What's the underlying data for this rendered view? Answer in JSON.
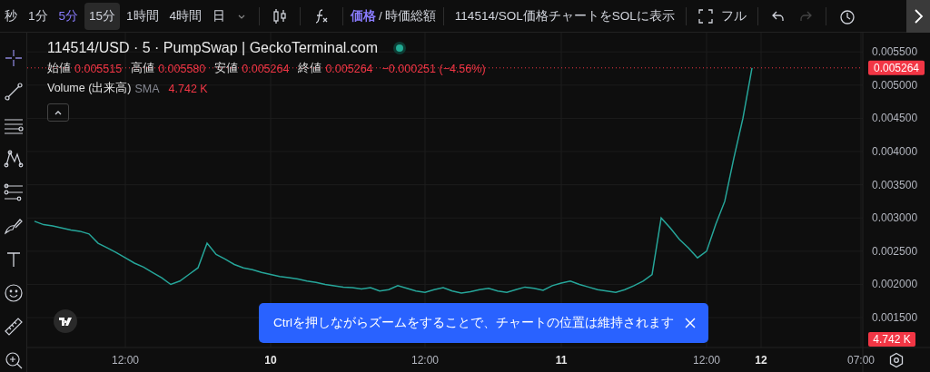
{
  "toolbar": {
    "intervals": [
      {
        "label": "秒",
        "selected": false,
        "hovered": false
      },
      {
        "label": "1分",
        "selected": false,
        "hovered": false
      },
      {
        "label": "5分",
        "selected": true,
        "hovered": false
      },
      {
        "label": "15分",
        "selected": false,
        "hovered": true
      },
      {
        "label": "1時間",
        "selected": false,
        "hovered": false
      },
      {
        "label": "4時間",
        "selected": false,
        "hovered": false
      },
      {
        "label": "日",
        "selected": false,
        "hovered": false
      }
    ],
    "value_toggle": [
      {
        "label": "価格",
        "selected": true
      },
      {
        "label": "時価総額",
        "selected": false
      }
    ],
    "toggle_separator": "/",
    "sol_link": "114514/SOL価格チャートをSOLに表示",
    "fullscreen": "フル",
    "undo": {
      "disabled": false
    },
    "redo": {
      "disabled": true
    }
  },
  "legend": {
    "title": "114514/USD · 5 · PumpSwap | GeckoTerminal.com",
    "market_open": true,
    "ohlc": [
      {
        "label": "始値",
        "value": "0.005515"
      },
      {
        "label": "高値",
        "value": "0.005580"
      },
      {
        "label": "安値",
        "value": "0.005264"
      },
      {
        "label": "終値",
        "value": "0.005264"
      }
    ],
    "change": "−0.000251 (−4.56%)",
    "volume": {
      "label": "Volume (出来高)",
      "study": "SMA",
      "value": "4.742 K"
    }
  },
  "chart": {
    "chart_data": {
      "type": "line",
      "ylim": [
        0.00105,
        0.00579
      ],
      "grid": true,
      "ref_lines": [
        {
          "axis": "y",
          "value": 0.00526,
          "color": "#f23645"
        }
      ],
      "categories": [
        null,
        null,
        null,
        null,
        null,
        null,
        null,
        null,
        null,
        null,
        "12:00",
        null,
        null,
        null,
        null,
        null,
        null,
        null,
        null,
        null,
        null,
        null,
        null,
        null,
        null,
        null,
        "10",
        null,
        null,
        null,
        null,
        null,
        null,
        null,
        null,
        null,
        null,
        null,
        null,
        null,
        null,
        null,
        null,
        "12:00",
        null,
        null,
        null,
        null,
        null,
        null,
        null,
        null,
        null,
        null,
        null,
        null,
        null,
        null,
        "11",
        null,
        null,
        null,
        null,
        null,
        null,
        null,
        null,
        null,
        null,
        null,
        null,
        null,
        null,
        null,
        "12:00",
        null,
        null,
        null,
        null,
        null,
        "12",
        null,
        null,
        null,
        null,
        null,
        null,
        null,
        null,
        null,
        null,
        "07:00"
      ],
      "yticks": [
        {
          "value": 0.0055,
          "label": "0.005500"
        },
        {
          "value": 0.005,
          "label": "0.005000"
        },
        {
          "value": 0.0045,
          "label": "0.004500"
        },
        {
          "value": 0.004,
          "label": "0.004000"
        },
        {
          "value": 0.0035,
          "label": "0.003500"
        },
        {
          "value": 0.003,
          "label": "0.003000"
        },
        {
          "value": 0.0025,
          "label": "0.002500"
        },
        {
          "value": 0.002,
          "label": "0.002000"
        },
        {
          "value": 0.0015,
          "label": "0.001500"
        }
      ],
      "series": [
        {
          "color": "#26a69a",
          "values": [
            0.00295,
            0.0029,
            0.00288,
            0.00285,
            0.00282,
            0.0028,
            0.00276,
            0.00262,
            0.00255,
            0.00248,
            0.0024,
            0.00232,
            0.00226,
            0.00218,
            0.0021,
            0.002,
            0.00205,
            0.00215,
            0.00225,
            0.00262,
            0.00245,
            0.00238,
            0.0023,
            0.00225,
            0.00222,
            0.00218,
            0.00215,
            0.00212,
            0.0021,
            0.00208,
            0.00205,
            0.00203,
            0.002,
            0.00198,
            0.00196,
            0.00195,
            0.00193,
            0.00195,
            0.0019,
            0.00192,
            0.00198,
            0.00194,
            0.0019,
            0.00188,
            0.00192,
            0.00195,
            0.0019,
            0.00187,
            0.00189,
            0.00192,
            0.00194,
            0.0019,
            0.00188,
            0.00192,
            0.00196,
            0.00194,
            0.00191,
            0.00198,
            0.00202,
            0.00205,
            0.002,
            0.00196,
            0.00192,
            0.0019,
            0.00188,
            0.00192,
            0.00198,
            0.00205,
            0.00215,
            0.003,
            0.00285,
            0.00268,
            0.00255,
            0.0024,
            0.0025,
            0.0029,
            0.00325,
            0.0039,
            0.0045,
            0.00526,
            null,
            null,
            null,
            null,
            null,
            null,
            null,
            null,
            null,
            null,
            null,
            null
          ]
        }
      ]
    },
    "last_price": "0.005264",
    "volume_badge": "4.742 K"
  },
  "toast": {
    "text": "Ctrlを押しながらズームをすることで、チャートの位置は維持されます"
  }
}
